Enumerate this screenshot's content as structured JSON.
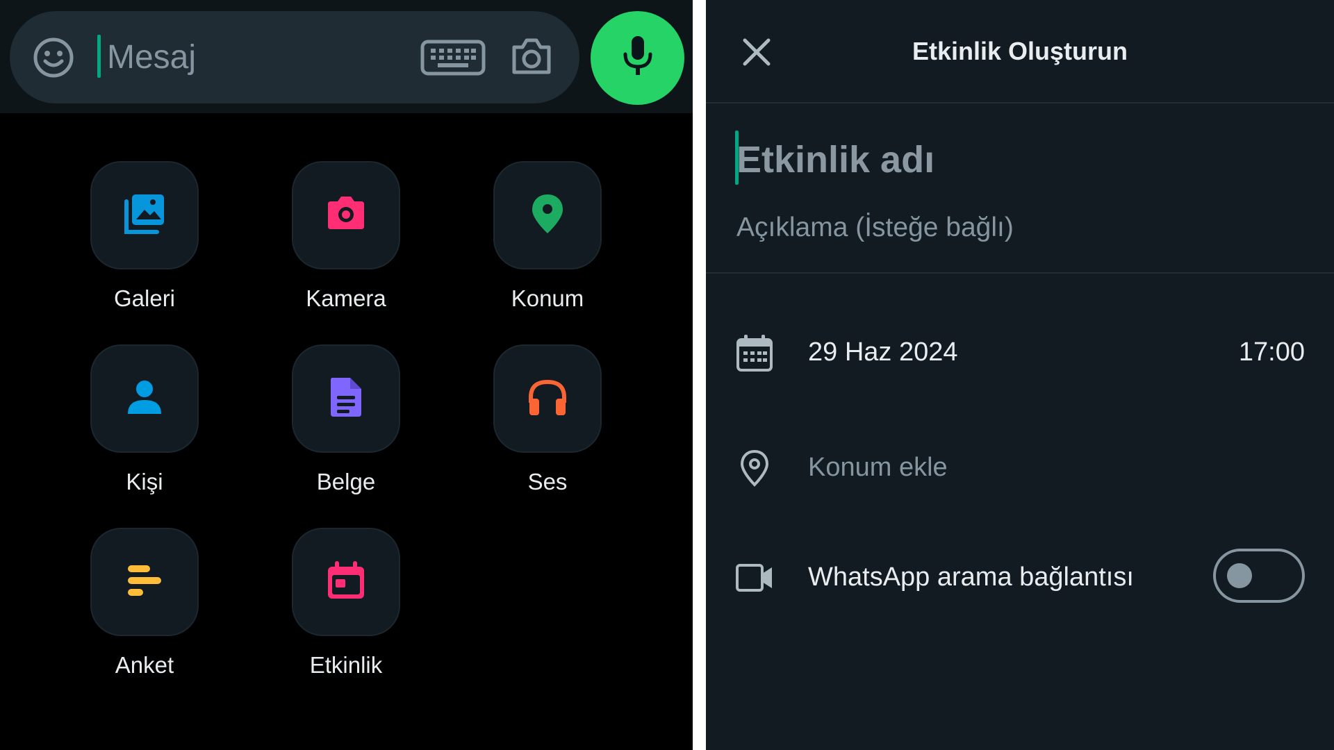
{
  "composer": {
    "placeholder": "Mesaj",
    "icons": [
      "smiley-icon",
      "keyboard-icon",
      "camera-icon",
      "mic-icon"
    ],
    "mic_color": "#25d366"
  },
  "attach_menu": {
    "items": [
      {
        "label": "Galeri",
        "icon": "gallery-icon",
        "color": "#0795dc"
      },
      {
        "label": "Kamera",
        "icon": "camera-icon",
        "color": "#ff2e74"
      },
      {
        "label": "Konum",
        "icon": "location-pin-icon",
        "color": "#1daa61"
      },
      {
        "label": "Kişi",
        "icon": "person-icon",
        "color": "#009de2"
      },
      {
        "label": "Belge",
        "icon": "document-icon",
        "color": "#7f66ff"
      },
      {
        "label": "Ses",
        "icon": "headphones-icon",
        "color": "#fa6533"
      },
      {
        "label": "Anket",
        "icon": "poll-icon",
        "color": "#ffbc38"
      },
      {
        "label": "Etkinlik",
        "icon": "calendar-event-icon",
        "color": "#ff2e74"
      }
    ]
  },
  "event_form": {
    "title": "Etkinlik Oluşturun",
    "name_placeholder": "Etkinlik adı",
    "description_placeholder": "Açıklama (İsteğe bağlı)",
    "date": "29 Haz 2024",
    "time": "17:00",
    "location_placeholder": "Konum ekle",
    "call_link_label": "WhatsApp arama bağlantısı",
    "call_link_enabled": false
  },
  "colors": {
    "accent": "#00a884",
    "panel_bg": "#121b22",
    "text_primary": "#e9edef",
    "text_muted": "#8696a0"
  }
}
